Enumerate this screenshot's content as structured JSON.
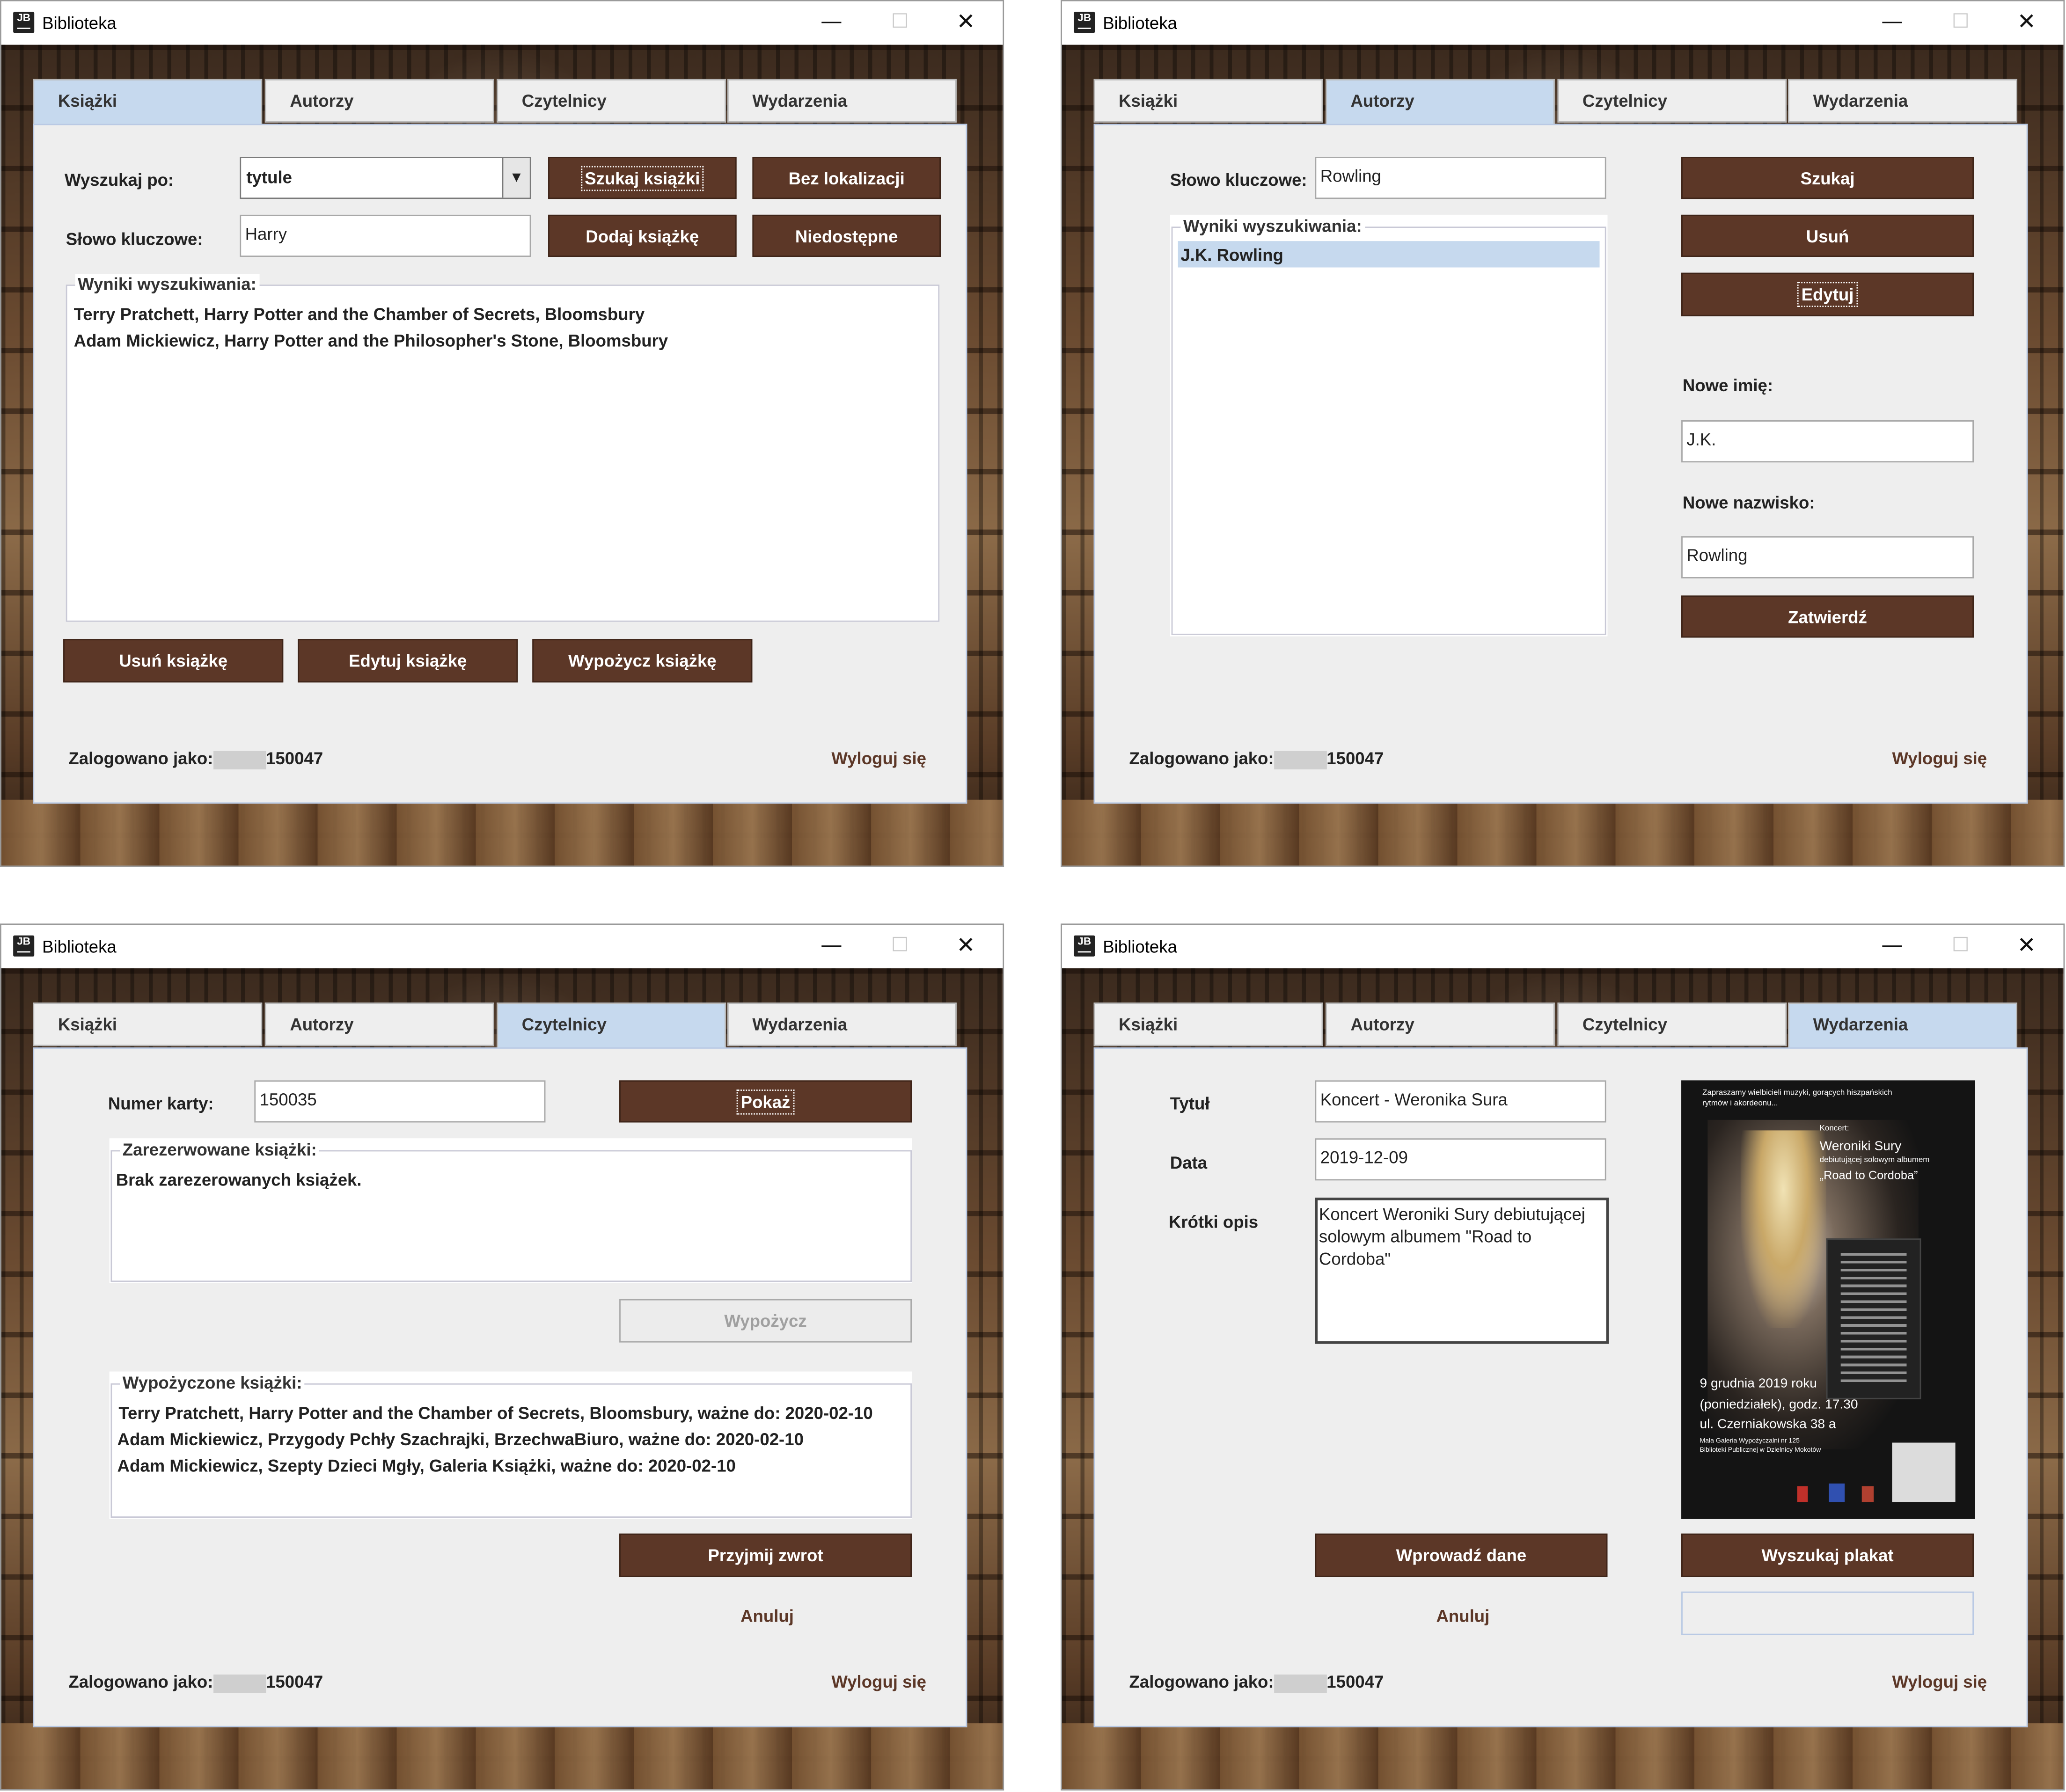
{
  "windows": [
    {
      "title": "Biblioteka",
      "tabs": [
        "Książki",
        "Autorzy",
        "Czytelnicy",
        "Wydarzenia"
      ],
      "active_tab": "Książki",
      "search_by_label": "Wyszukaj po:",
      "search_by_value": "tytule",
      "keyword_label": "Słowo kluczowe:",
      "keyword_value": "Harry",
      "buttons": {
        "search": "Szukaj książki",
        "no_location": "Bez lokalizacji",
        "add": "Dodaj książkę",
        "unavailable": "Niedostępne",
        "delete": "Usuń książkę",
        "edit": "Edytuj książkę",
        "borrow": "Wypożycz książkę"
      },
      "results_title": "Wyniki wyszukiwania:",
      "results": [
        "Terry Pratchett, Harry Potter and the Chamber of Secrets, Bloomsbury",
        "Adam Mickiewicz, Harry Potter and the Philosopher's Stone, Bloomsbury"
      ],
      "logged_in_label": "Zalogowano jako:",
      "user_id": "150047",
      "logout": "Wyloguj się"
    },
    {
      "title": "Biblioteka",
      "tabs": [
        "Książki",
        "Autorzy",
        "Czytelnicy",
        "Wydarzenia"
      ],
      "active_tab": "Autorzy",
      "keyword_label": "Słowo kluczowe:",
      "keyword_value": "Rowling",
      "results_title": "Wyniki wyszukiwania:",
      "results": [
        "J.K. Rowling"
      ],
      "buttons": {
        "search": "Szukaj",
        "delete": "Usuń",
        "edit": "Edytuj",
        "confirm": "Zatwierdź"
      },
      "new_first_name_label": "Nowe imię:",
      "new_first_name_value": "J.K.",
      "new_last_name_label": "Nowe nazwisko:",
      "new_last_name_value": "Rowling",
      "logged_in_label": "Zalogowano jako:",
      "user_id": "150047",
      "logout": "Wyloguj się"
    },
    {
      "title": "Biblioteka",
      "tabs": [
        "Książki",
        "Autorzy",
        "Czytelnicy",
        "Wydarzenia"
      ],
      "active_tab": "Czytelnicy",
      "card_label": "Numer karty:",
      "card_value": "150035",
      "buttons": {
        "show": "Pokaż",
        "borrow": "Wypożycz",
        "accept_return": "Przyjmij zwrot"
      },
      "reserved_title": "Zarezerwowane książki:",
      "reserved": [
        "Brak zarezerowanych książek."
      ],
      "borrowed_title": "Wypożyczone książki:",
      "borrowed": [
        "Terry Pratchett, Harry Potter and the Chamber of Secrets, Bloomsbury, ważne do: 2020-02-10",
        "Adam Mickiewicz, Przygody Pchły Szachrajki, BrzechwaBiuro, ważne do: 2020-02-10",
        "Adam Mickiewicz, Szepty Dzieci Mgły, Galeria Książki, ważne do: 2020-02-10"
      ],
      "cancel": "Anuluj",
      "logged_in_label": "Zalogowano jako:",
      "user_id": "150047",
      "logout": "Wyloguj się"
    },
    {
      "title": "Biblioteka",
      "tabs": [
        "Książki",
        "Autorzy",
        "Czytelnicy",
        "Wydarzenia"
      ],
      "active_tab": "Wydarzenia",
      "title_label": "Tytuł",
      "title_value": "Koncert - Weronika Sura",
      "date_label": "Data",
      "date_value": "2019-12-09",
      "desc_label": "Krótki opis",
      "desc_value": "Koncert Weroniki Sury debiutującej solowym albumem \"Road to Cordoba\"",
      "buttons": {
        "submit": "Wprowadź dane",
        "find_poster": "Wyszukaj plakat"
      },
      "cancel": "Anuluj",
      "poster": {
        "intro": "Zapraszamy wielbicieli muzyki, gorących hiszpańskich rytmów i akordeonu...",
        "concert": "Koncert:",
        "artist": "Weroniki Sury",
        "debut": "debiutującej solowym albumem",
        "album": "„Road to Cordoba”",
        "date": "9 grudnia 2019 roku",
        "time": "(poniedziałek), godz. 17.30",
        "address": "ul. Czerniakowska 38 a",
        "venue_line1": "Mała Galeria Wypożyczalni nr 125",
        "venue_line2": "Biblioteki Publicznej w Dzielnicy Mokotów"
      },
      "logged_in_label": "Zalogowano jako:",
      "user_id": "150047",
      "logout": "Wyloguj się"
    }
  ]
}
